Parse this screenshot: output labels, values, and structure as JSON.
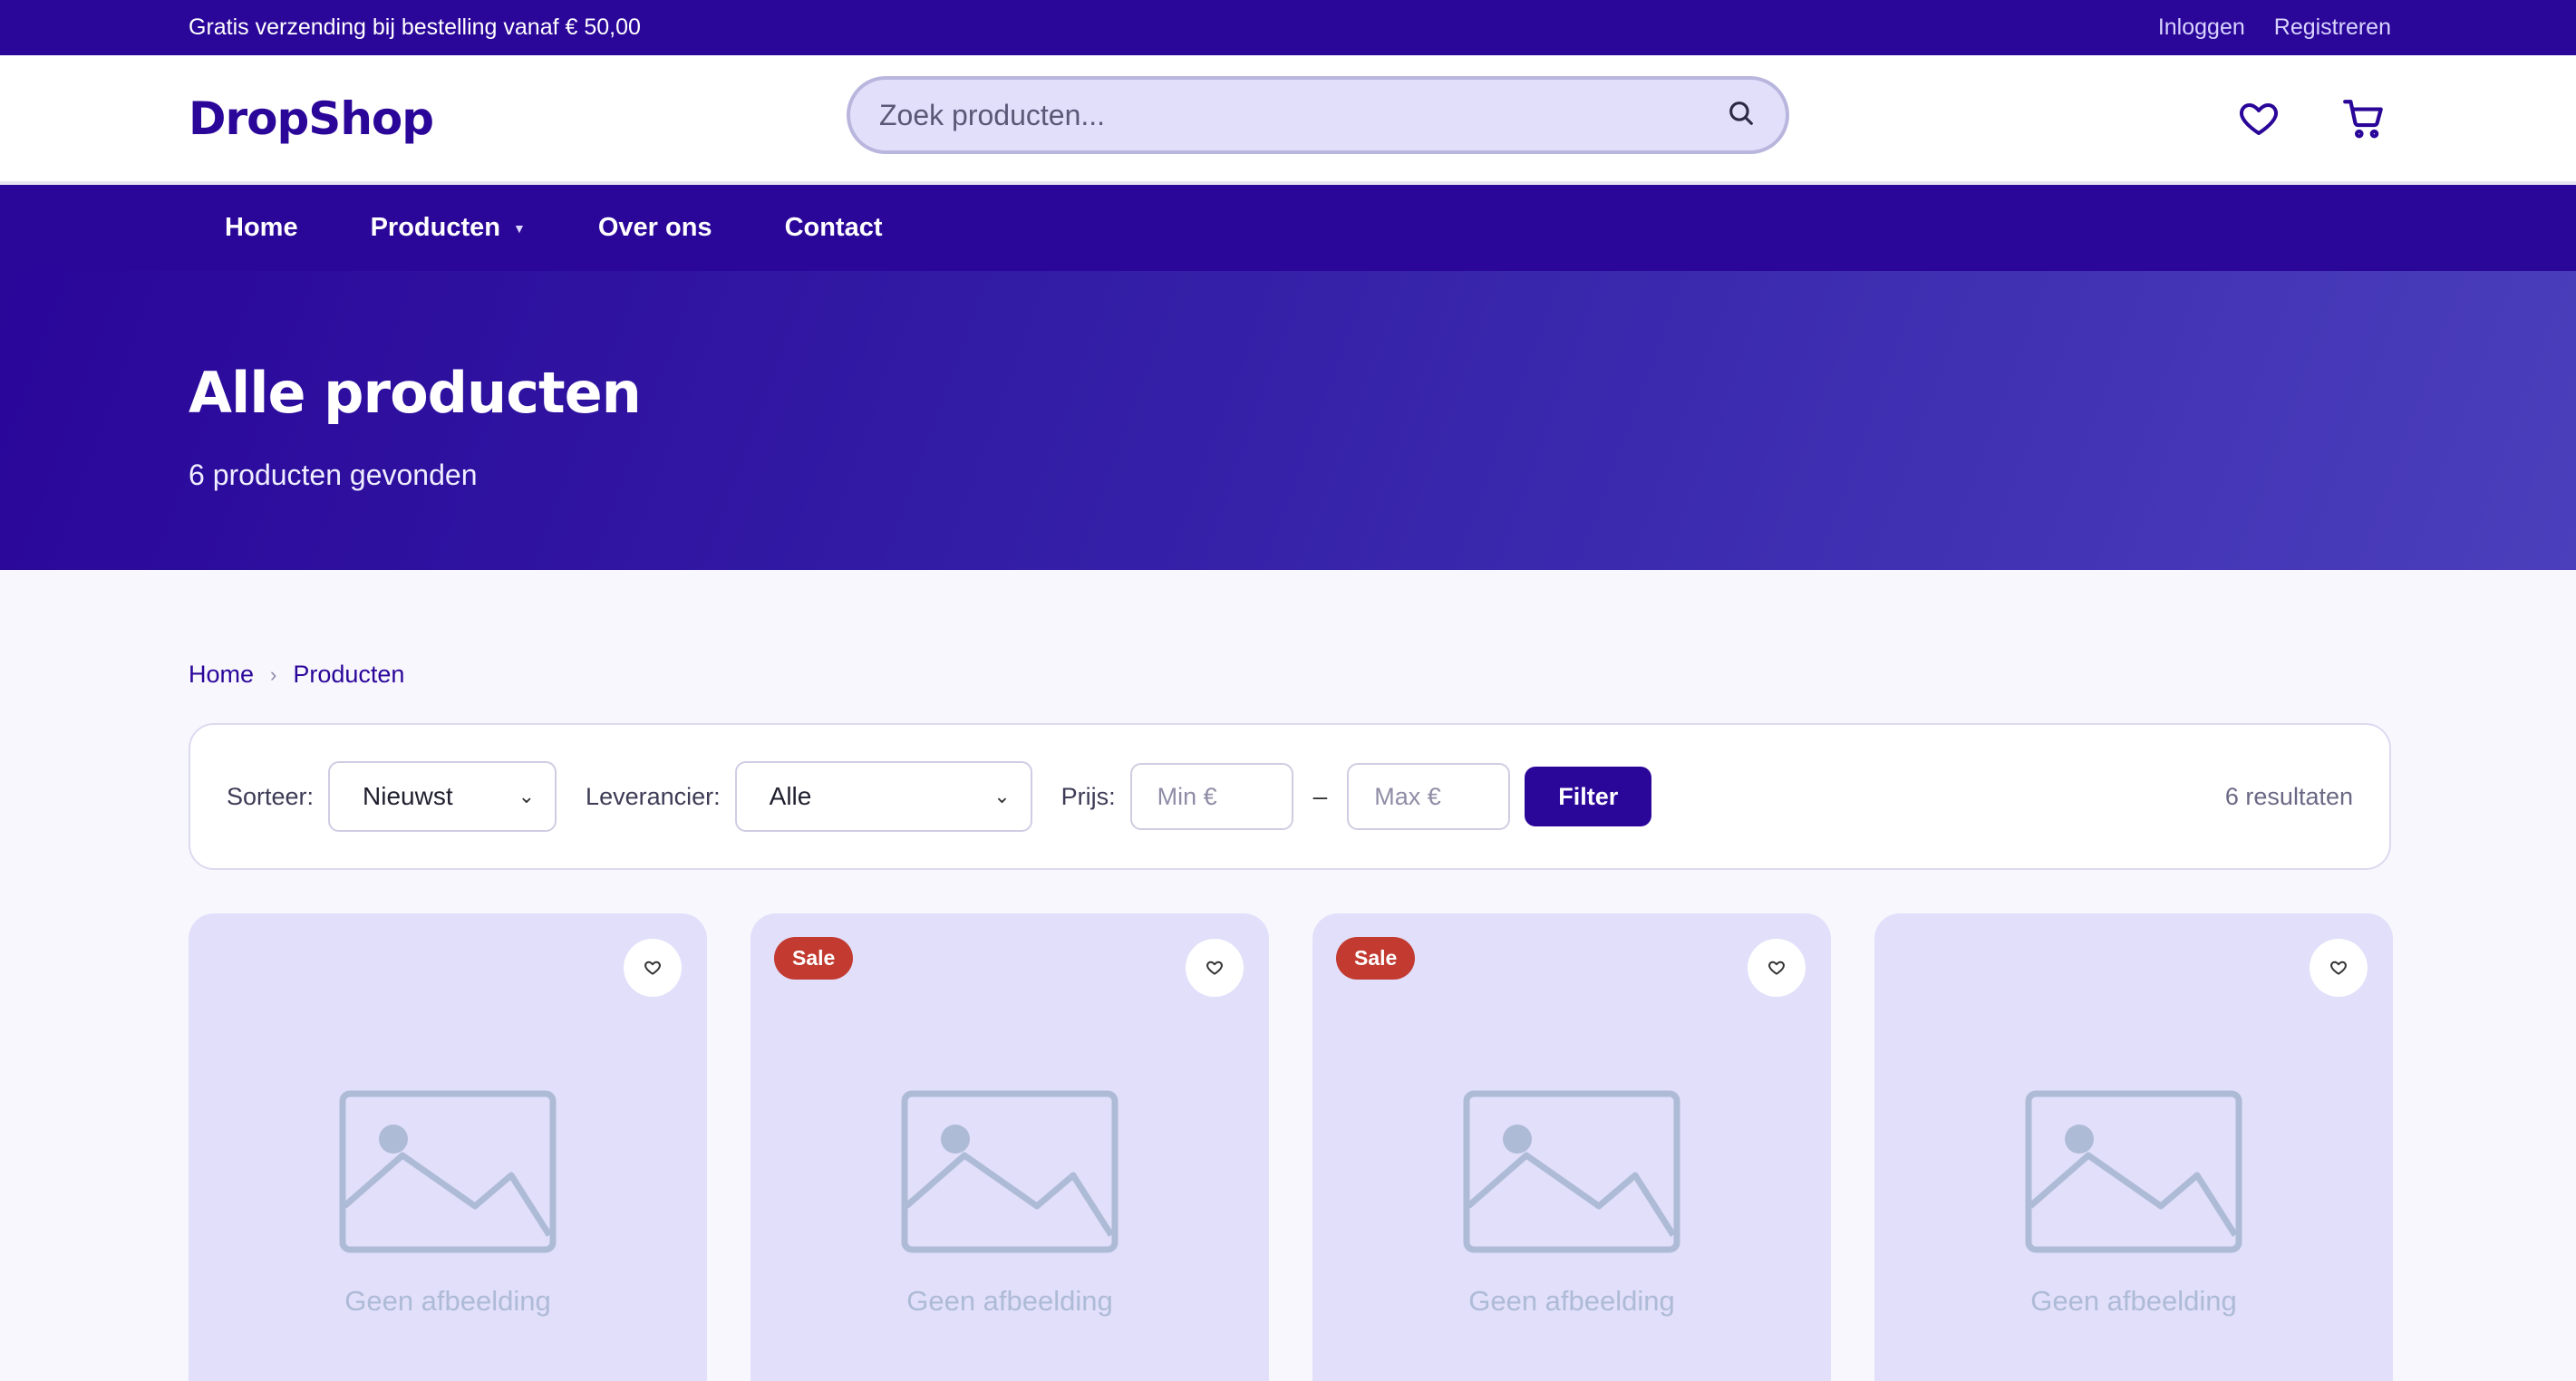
{
  "topbar": {
    "promo": "Gratis verzending bij bestelling vanaf € 50,00",
    "login": "Inloggen",
    "register": "Registreren"
  },
  "header": {
    "logo": "DropShop",
    "search_placeholder": "Zoek producten...",
    "icons": [
      "heart-icon",
      "cart-icon"
    ]
  },
  "nav": {
    "items": [
      {
        "label": "Home"
      },
      {
        "label": "Producten",
        "has_dropdown": true
      },
      {
        "label": "Over ons"
      },
      {
        "label": "Contact"
      }
    ]
  },
  "hero": {
    "title": "Alle producten",
    "subtitle": "6 producten gevonden"
  },
  "breadcrumb": [
    "Home",
    "Producten"
  ],
  "filters": {
    "sort_label": "Sorteer:",
    "sort_value": "Nieuwst",
    "supplier_label": "Leverancier:",
    "supplier_value": "Alle",
    "price_label": "Prijs:",
    "min_placeholder": "Min €",
    "dash": "–",
    "max_placeholder": "Max €",
    "button": "Filter",
    "results": "6 resultaten"
  },
  "products": [
    {
      "badge": "",
      "image_caption": "Geen afbeelding"
    },
    {
      "badge": "Sale",
      "image_caption": "Geen afbeelding"
    },
    {
      "badge": "Sale",
      "image_caption": "Geen afbeelding"
    },
    {
      "badge": "",
      "image_caption": "Geen afbeelding"
    }
  ],
  "colors": {
    "brand": "#2a0699",
    "sale": "#c23a30",
    "card_bg": "#e1dffa",
    "placeholder": "#aebbd6"
  }
}
